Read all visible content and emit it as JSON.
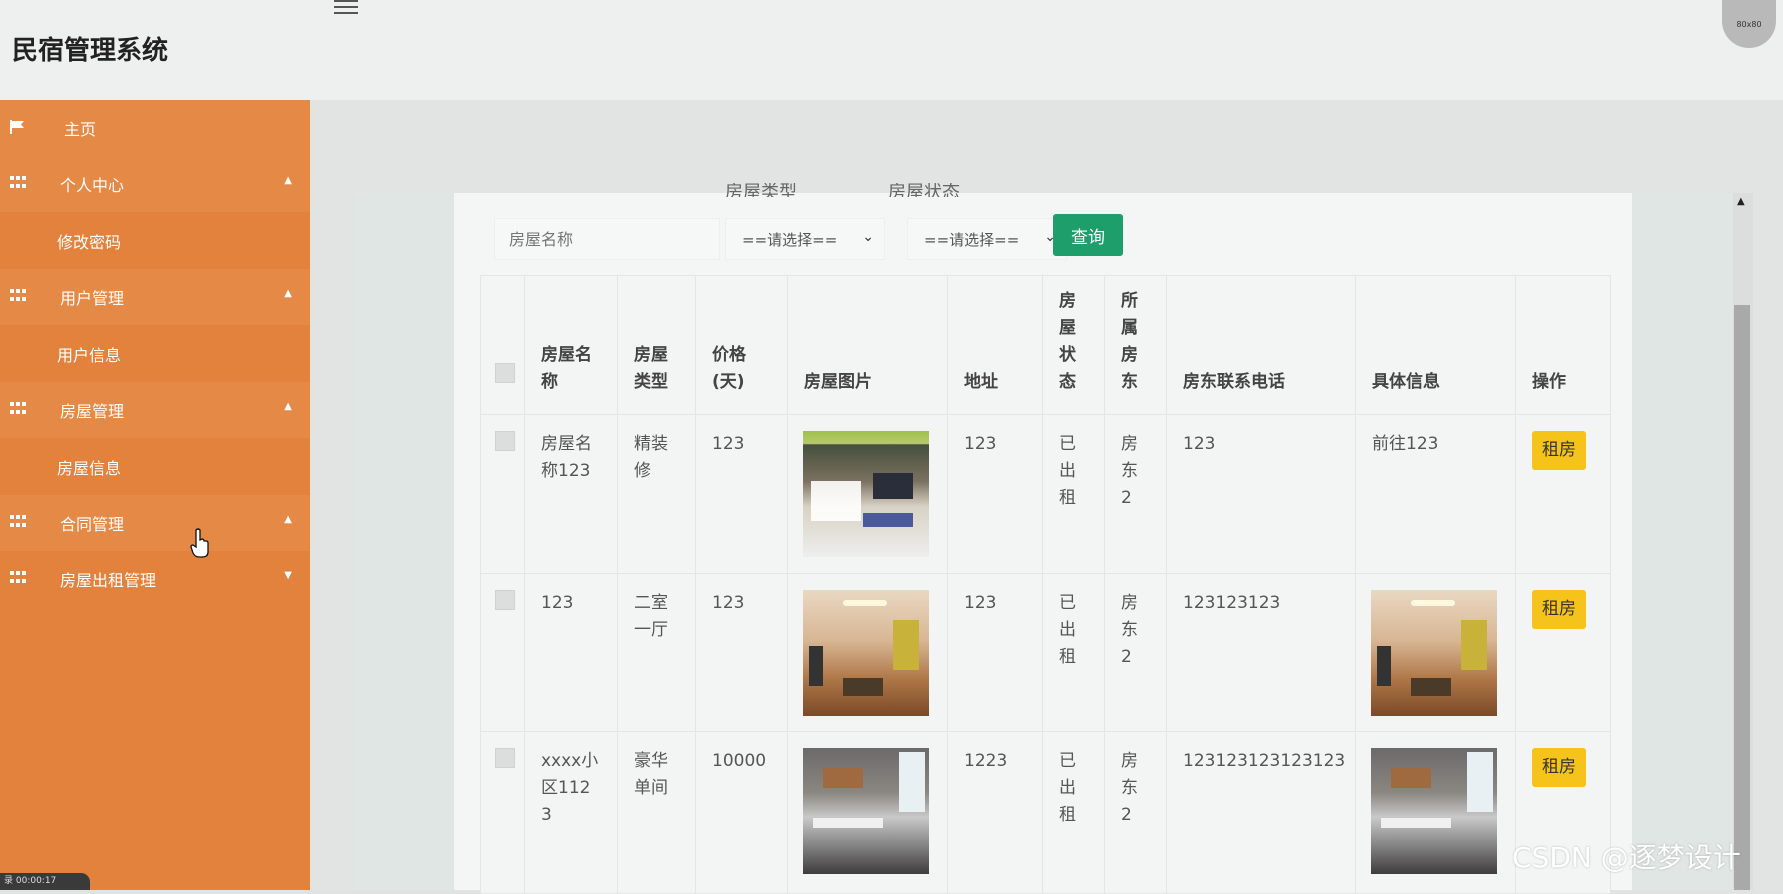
{
  "header": {
    "app_title": "民宿管理系统",
    "avatar_text": "80x80"
  },
  "sidebar": {
    "home": "主页",
    "groups": [
      {
        "label": "个人中心",
        "children": [
          "修改密码"
        ]
      },
      {
        "label": "用户管理",
        "children": [
          "用户信息"
        ]
      },
      {
        "label": "房屋管理",
        "children": [
          "房屋信息"
        ]
      },
      {
        "label": "合同管理",
        "children": []
      },
      {
        "label": "房屋出租管理",
        "children": []
      }
    ]
  },
  "filters": {
    "name_placeholder": "房屋名称",
    "type_label": "房屋类型",
    "type_value": "==请选择==",
    "status_label": "房屋状态",
    "status_value": "==请选择==",
    "query_button": "查询"
  },
  "table": {
    "headers": [
      "房屋名称",
      "房屋类型",
      "价格(天)",
      "房屋图片",
      "地址",
      "房屋状态",
      "所属房东",
      "房东联系电话",
      "具体信息",
      "操作"
    ],
    "rows": [
      {
        "name": "房屋名称123",
        "type": "精装修",
        "price": "123",
        "address": "123",
        "status": "已出租",
        "landlord": "房东2",
        "phone": "123",
        "detail_text": "前往123",
        "action": "租房"
      },
      {
        "name": "123",
        "type": "二室一厅",
        "price": "123",
        "address": "123",
        "status": "已出租",
        "landlord": "房东2",
        "phone": "123123123",
        "detail_text": "",
        "action": "租房"
      },
      {
        "name": "xxxx小区1123",
        "type": "豪华单间",
        "price": "10000",
        "address": "1223",
        "status": "已出租",
        "landlord": "房东2",
        "phone": "123123123123123",
        "detail_text": "",
        "action": "租房"
      }
    ]
  },
  "watermark": "CSDN @逐梦设计",
  "bottom_status": "录 00:00:17"
}
